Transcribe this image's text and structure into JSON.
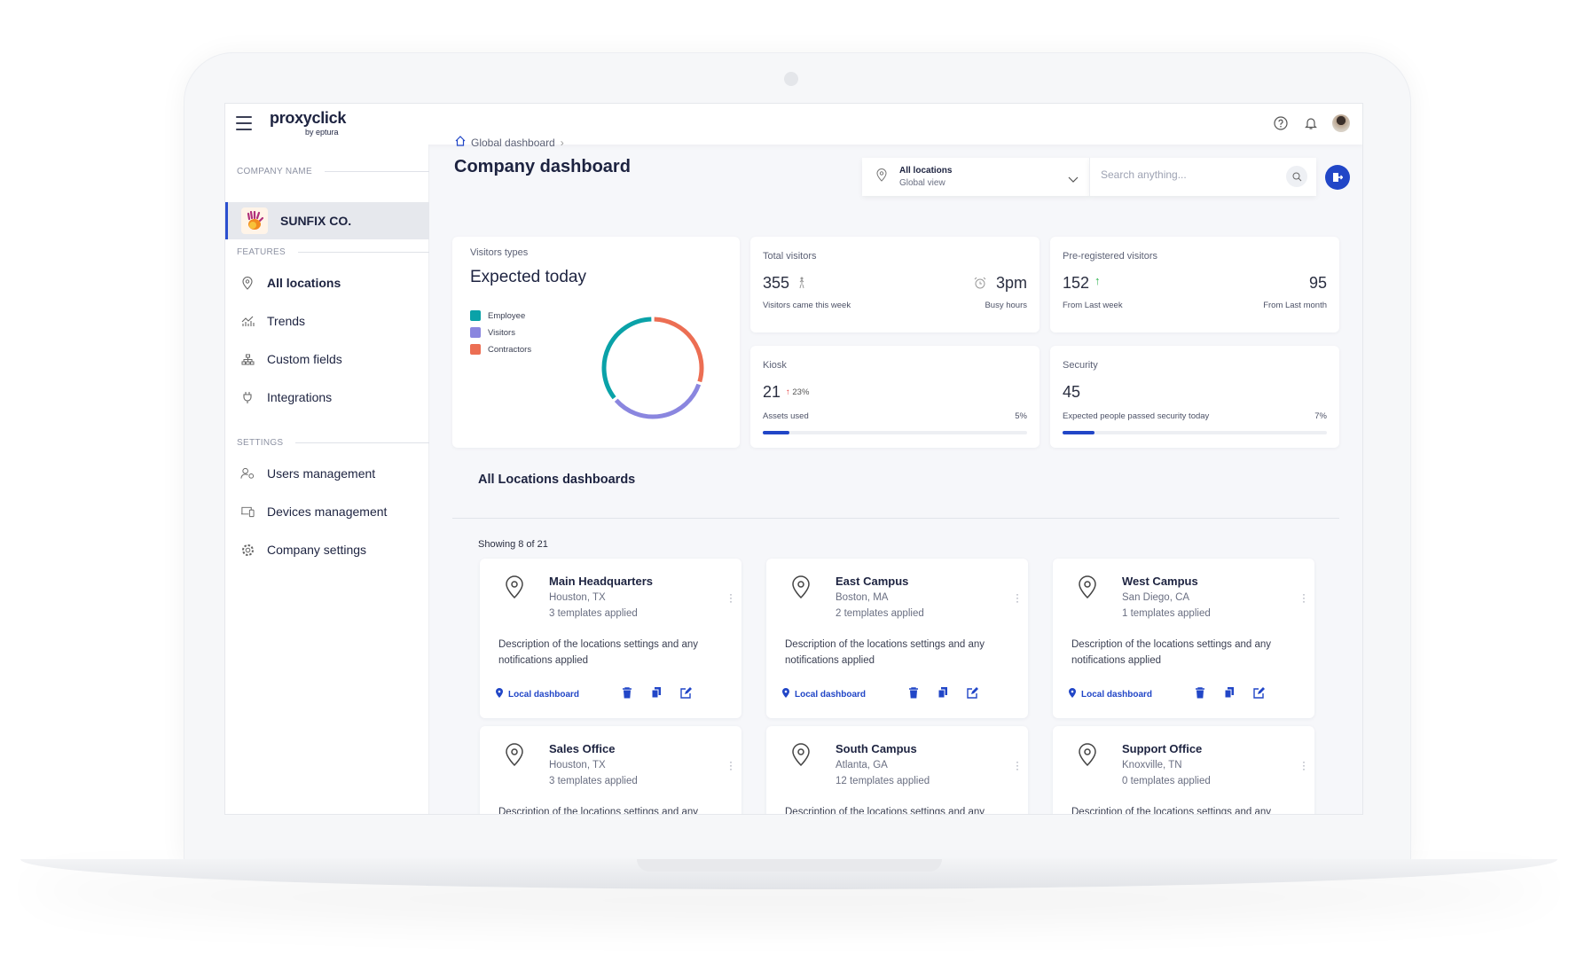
{
  "app": {
    "logo_main": "proxyclick",
    "logo_sub": "by eptura"
  },
  "header": {
    "icons": [
      "help-icon",
      "bell-icon",
      "user-avatar"
    ]
  },
  "sidebar": {
    "company_section": "COMPANY NAME",
    "company": "SUNFIX CO.",
    "features_section": "FEATURES",
    "features": [
      {
        "label": "All locations",
        "icon": "location-pin-icon",
        "active": true
      },
      {
        "label": "Trends",
        "icon": "chart-icon"
      },
      {
        "label": "Custom fields",
        "icon": "hierarchy-icon"
      },
      {
        "label": "Integrations",
        "icon": "plug-icon"
      }
    ],
    "settings_section": "SETTINGS",
    "settings": [
      {
        "label": "Users management",
        "icon": "users-gear-icon"
      },
      {
        "label": "Devices management",
        "icon": "devices-icon"
      },
      {
        "label": "Company settings",
        "icon": "gear-icon"
      }
    ]
  },
  "breadcrumb": {
    "home": "Global dashboard"
  },
  "page_title": "Company dashboard",
  "location_selector": {
    "title": "All locations",
    "subtitle": "Global view"
  },
  "search": {
    "placeholder": "Search anything..."
  },
  "colors": {
    "accent": "#2146c7",
    "employee": "#0aa2a8",
    "visitors": "#8a86df",
    "contractors": "#ec6e53"
  },
  "visitor_types": {
    "label": "Visitors types",
    "title": "Expected today",
    "legend": [
      "Employee",
      "Visitors",
      "Contractors"
    ],
    "chart_data": {
      "type": "pie",
      "categories": [
        "Employee",
        "Visitors",
        "Contractors"
      ],
      "values": [
        36,
        34,
        30
      ]
    }
  },
  "total_visitors": {
    "label": "Total visitors",
    "value": "355",
    "value_caption": "Visitors came this week",
    "busy": "3pm",
    "busy_caption": "Busy hours"
  },
  "preregistered": {
    "label": "Pre-registered visitors",
    "value": "152",
    "value_caption": "From Last week",
    "month": "95",
    "month_caption": "From Last month"
  },
  "kiosk": {
    "label": "Kiosk",
    "value": "21",
    "change": "23%",
    "caption": "Assets used",
    "percent_label": "5%",
    "progress": 0.1
  },
  "security": {
    "label": "Security",
    "value": "45",
    "caption": "Expected people passed security today",
    "percent_label": "7%",
    "progress": 0.12
  },
  "locations": {
    "title": "All Locations dashboards",
    "showing": "Showing 8 of 21",
    "action_label": "Local dashboard",
    "items": [
      {
        "name": "Main Headquarters",
        "city": "Houston, TX",
        "templates": "3 templates applied",
        "desc": "Description of the locations settings and any notifications applied"
      },
      {
        "name": "East Campus",
        "city": "Boston, MA",
        "templates": "2 templates applied",
        "desc": "Description of the locations settings and any notifications applied"
      },
      {
        "name": "West Campus",
        "city": "San Diego, CA",
        "templates": "1 templates applied",
        "desc": "Description of the locations settings and any notifications applied"
      },
      {
        "name": "Sales Office",
        "city": "Houston, TX",
        "templates": "3 templates applied",
        "desc": "Description of the locations settings and any notifications applied"
      },
      {
        "name": "South Campus",
        "city": "Atlanta, GA",
        "templates": "12 templates applied",
        "desc": "Description of the locations settings and any notifications applied"
      },
      {
        "name": "Support Office",
        "city": "Knoxville, TN",
        "templates": "0 templates applied",
        "desc": "Description of the locations settings and any notifications applied"
      }
    ]
  }
}
